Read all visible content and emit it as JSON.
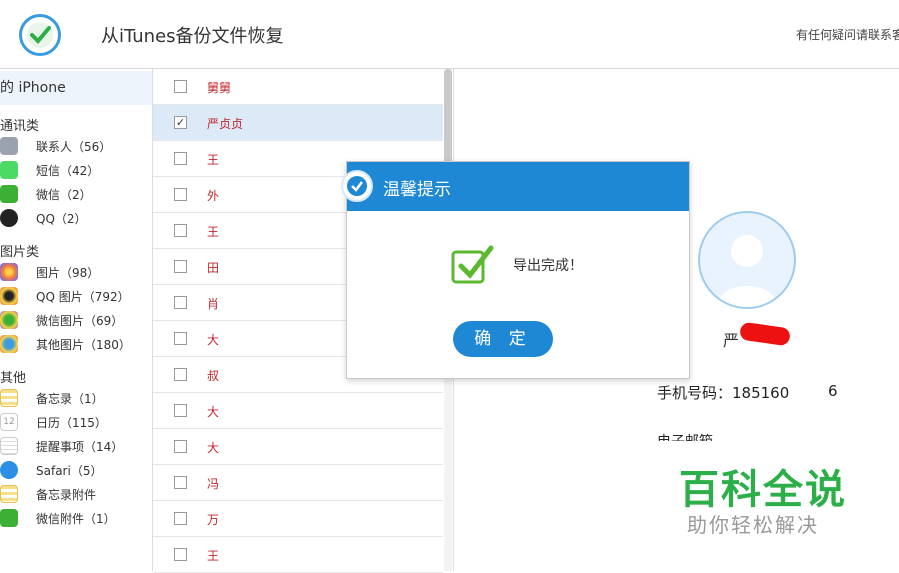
{
  "header": {
    "title": "从iTunes备份文件恢复",
    "help_text": "有任何疑问请联系客"
  },
  "sidebar": {
    "device": "的 iPhone",
    "categories": [
      {
        "label": "通讯类",
        "items": [
          {
            "label": "联系人（56）",
            "icon": "contacts-icon"
          },
          {
            "label": "短信（42）",
            "icon": "sms-icon"
          },
          {
            "label": "微信（2）",
            "icon": "wechat-icon"
          },
          {
            "label": "QQ（2）",
            "icon": "qq-icon"
          }
        ]
      },
      {
        "label": "图片类",
        "items": [
          {
            "label": "图片（98）",
            "icon": "photos-icon"
          },
          {
            "label": "QQ 图片（792）",
            "icon": "qq-photos-icon"
          },
          {
            "label": "微信图片（69）",
            "icon": "wechat-photos-icon"
          },
          {
            "label": "其他图片（180）",
            "icon": "other-photos-icon"
          }
        ]
      },
      {
        "label": "其他",
        "items": [
          {
            "label": "备忘录（1）",
            "icon": "notes-icon"
          },
          {
            "label": "日历（115）",
            "icon": "calendar-icon"
          },
          {
            "label": "提醒事项（14）",
            "icon": "reminders-icon"
          },
          {
            "label": "Safari（5）",
            "icon": "safari-icon"
          },
          {
            "label": "备忘录附件",
            "icon": "notes-attachment-icon"
          },
          {
            "label": "微信附件（1）",
            "icon": "wechat-attachment-icon"
          }
        ]
      }
    ]
  },
  "contact_list": [
    {
      "name": "舅舅",
      "checked": false
    },
    {
      "name": "严贞贞",
      "checked": true
    },
    {
      "name": "王",
      "checked": false
    },
    {
      "name": "外",
      "checked": false
    },
    {
      "name": "王",
      "checked": false
    },
    {
      "name": "田",
      "checked": false
    },
    {
      "name": "肖",
      "checked": false
    },
    {
      "name": "大",
      "checked": false
    },
    {
      "name": "叔",
      "checked": false
    },
    {
      "name": "大",
      "checked": false
    },
    {
      "name": "大",
      "checked": false
    },
    {
      "name": "冯",
      "checked": false
    },
    {
      "name": "万",
      "checked": false
    },
    {
      "name": "王",
      "checked": false
    }
  ],
  "detail": {
    "name": "严",
    "phone_label": "手机号码：185160",
    "phone_tail": "6",
    "email_label": "电子邮箱"
  },
  "dialog": {
    "title": "温馨提示",
    "message": "导出完成！",
    "ok_label": "确 定"
  },
  "watermark": {
    "main": "百科全说",
    "sub": "助你轻松解决"
  },
  "colors": {
    "accent": "#1e88d4",
    "name_red": "#c0272d",
    "watermark_green": "#2cae48"
  }
}
